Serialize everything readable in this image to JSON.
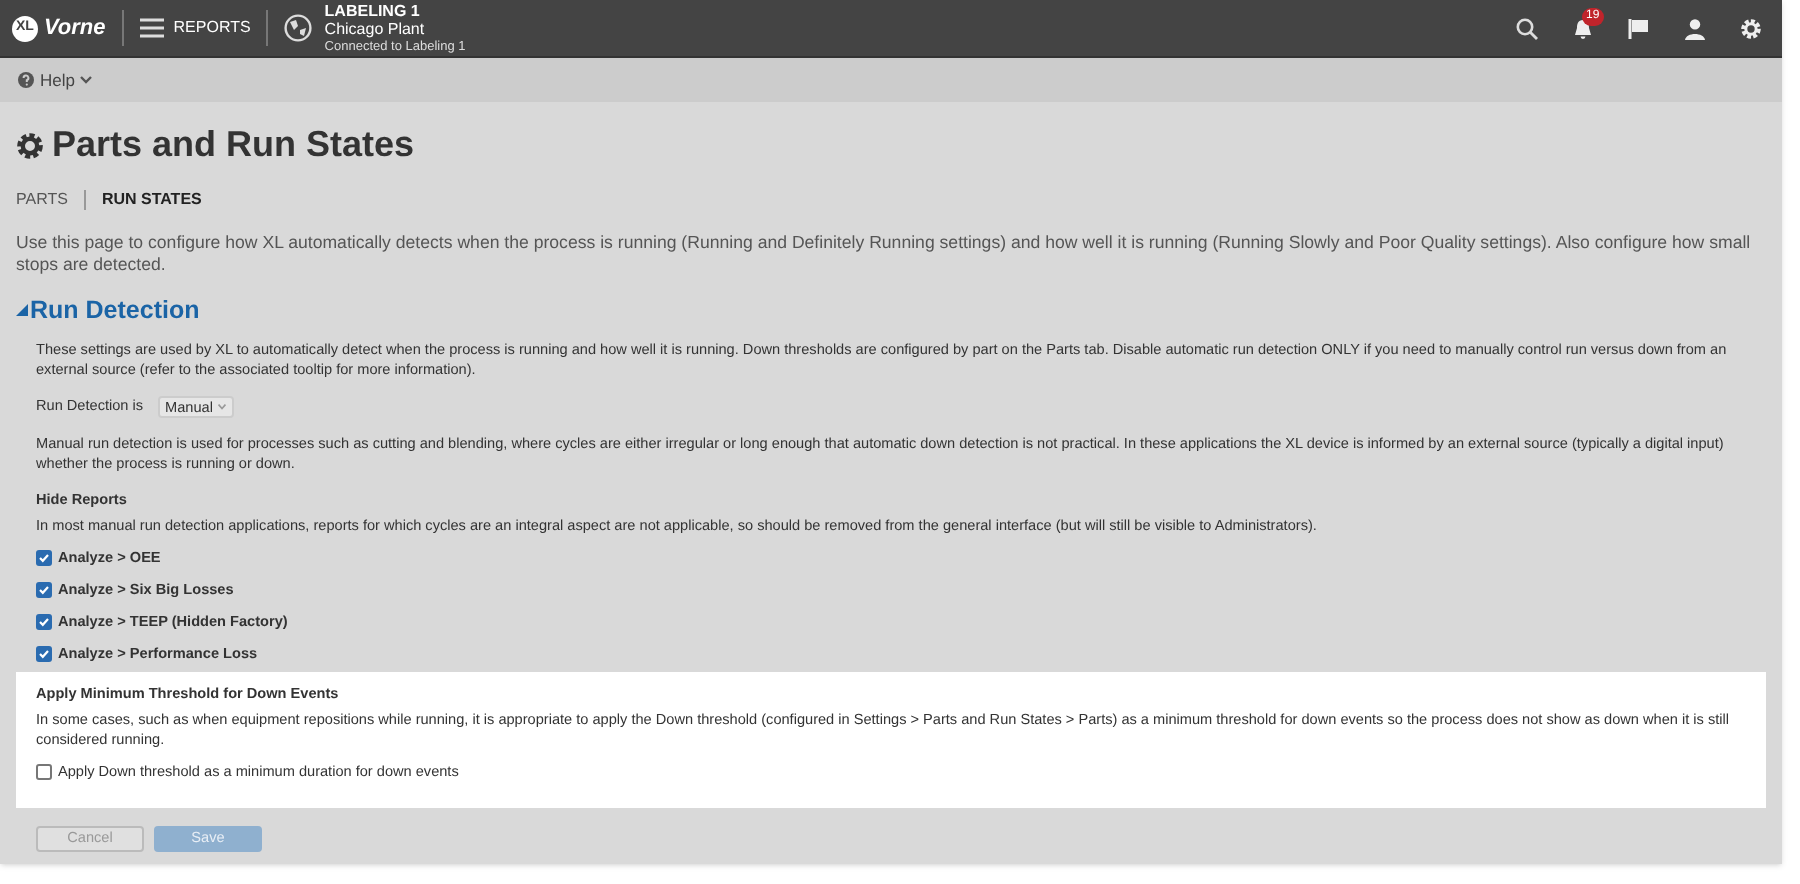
{
  "top_bar": {
    "logo_badge": "XL",
    "logo_text": "Vorne",
    "menu_label": "REPORTS",
    "device": {
      "name": "LABELING 1",
      "site": "Chicago Plant",
      "status": "Connected to Labeling 1"
    },
    "notification_count": "19"
  },
  "help": {
    "label": "Help"
  },
  "page": {
    "title": "Parts and Run States",
    "tabs": [
      {
        "label": "PARTS",
        "selected": false
      },
      {
        "label": "RUN STATES",
        "selected": true
      }
    ],
    "intro": "Use this page to configure how XL automatically detects when the process is running (Running and Definitely Running settings) and how well it is running (Running Slowly and Poor Quality settings). Also configure how small stops are detected."
  },
  "section": {
    "title": "Run Detection",
    "expanded": true,
    "description": "These settings are used by XL to automatically detect when the process is running and how well it is running. Down thresholds are configured by part on the Parts tab. Disable automatic run detection ONLY if you need to manually control run versus down from an external source (refer to the associated tooltip for more information).",
    "run_detection": {
      "label": "Run Detection is",
      "value": "Manual"
    },
    "manual_note": "Manual run detection is used for processes such as cutting and blending, where cycles are either irregular or long enough that automatic down detection is not practical. In these applications the XL device is informed by an external source (typically a digital input) whether the process is running or down.",
    "hide_reports": {
      "title": "Hide Reports",
      "description": "In most manual run detection applications, reports for which cycles are an integral aspect are not applicable, so should be removed from the general interface (but will still be visible to Administrators).",
      "options": [
        {
          "label": "Analyze > OEE",
          "checked": true
        },
        {
          "label": "Analyze > Six Big Losses",
          "checked": true
        },
        {
          "label": "Analyze > TEEP (Hidden Factory)",
          "checked": true
        },
        {
          "label": "Analyze > Performance Loss",
          "checked": true
        }
      ]
    },
    "threshold": {
      "title": "Apply Minimum Threshold for Down Events",
      "description": "In some cases, such as when equipment repositions while running, it is appropriate to apply the Down threshold (configured in Settings > Parts and Run States > Parts) as a minimum threshold for down events so the process does not show as down when it is still considered running.",
      "option": {
        "label": "Apply Down threshold as a minimum duration for down events",
        "checked": false
      }
    }
  },
  "buttons": [
    {
      "label": "Cancel",
      "kind": "secondary",
      "disabled": true
    },
    {
      "label": "Save",
      "kind": "primary",
      "disabled": true
    }
  ]
}
